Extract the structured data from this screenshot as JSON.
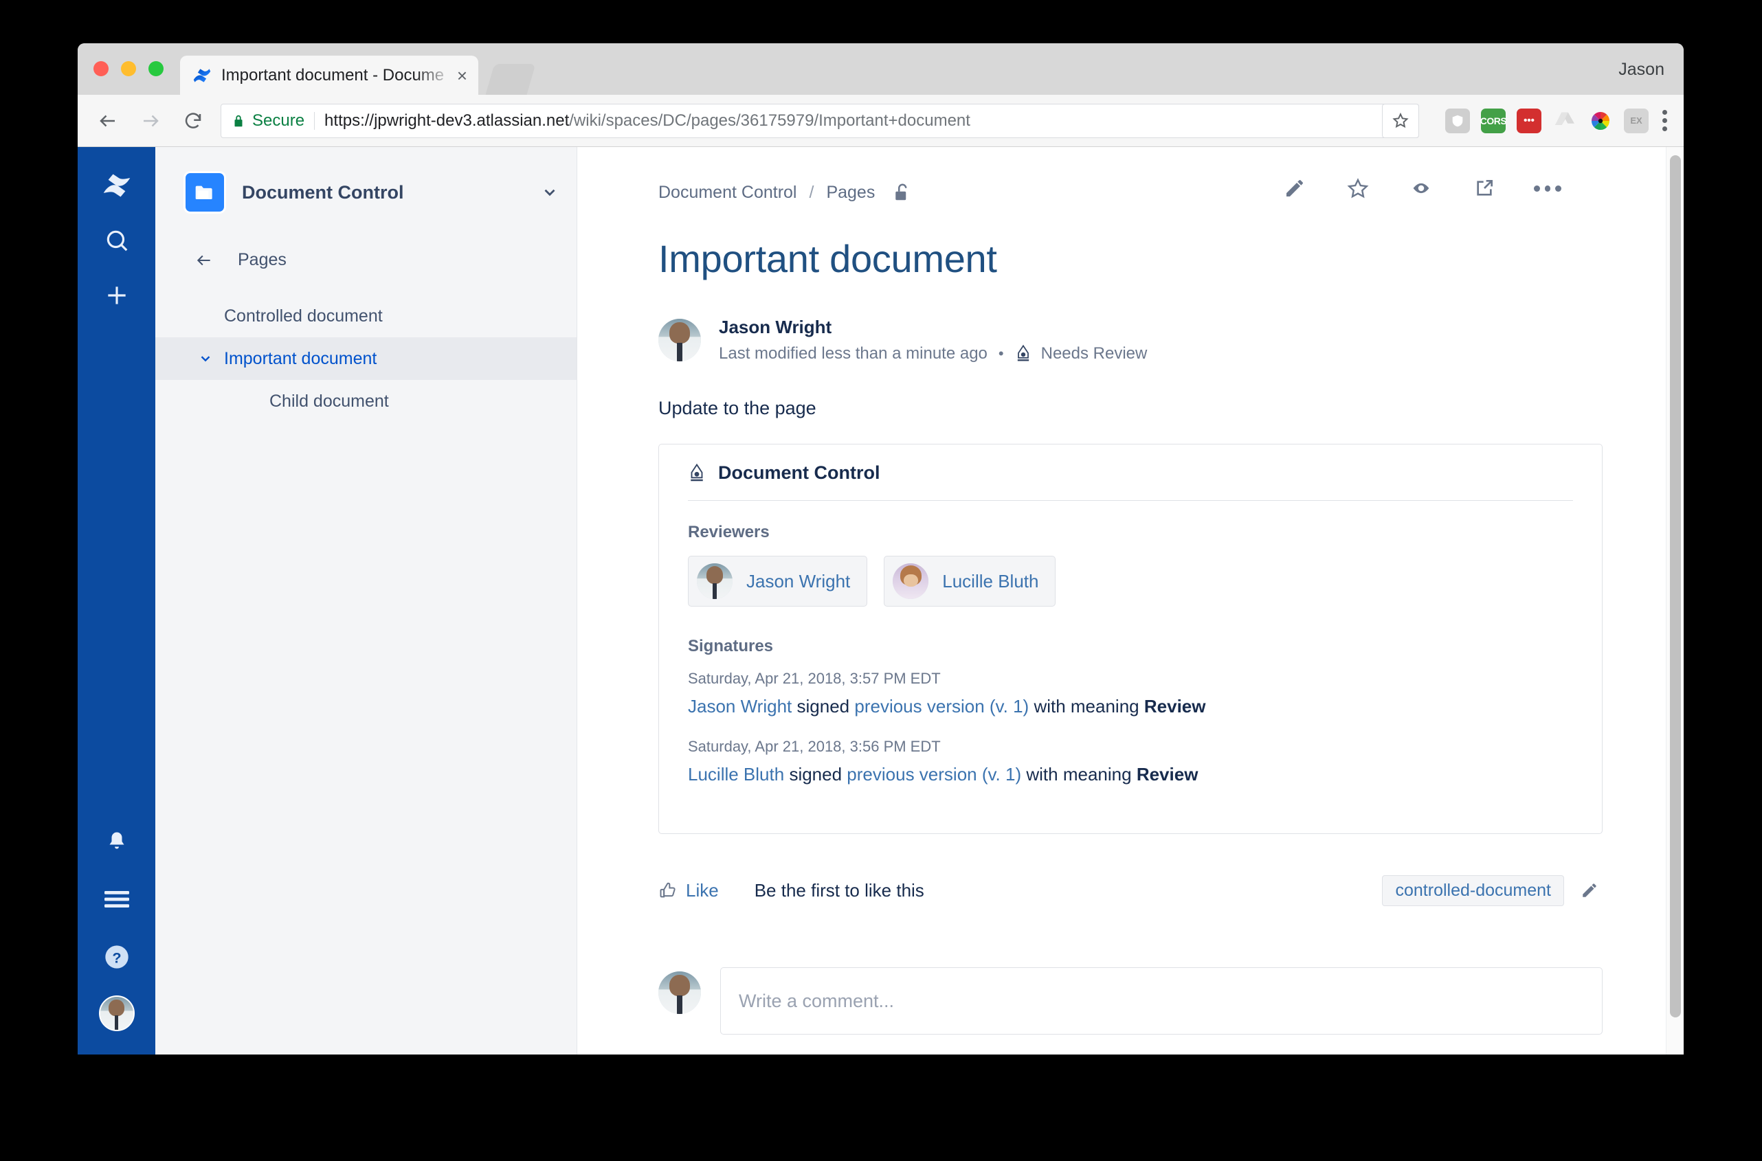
{
  "browser": {
    "profile_name": "Jason",
    "tab": {
      "title": "Important document - Docume",
      "close_label": "×",
      "favicon": "confluence-logo-icon"
    },
    "omnibox": {
      "security_label": "Secure",
      "url_scheme": "https://",
      "url_host": "jpwright-dev3.atlassian.net",
      "url_path": "/wiki/spaces/DC/pages/36175979/Important+document"
    },
    "extensions": [
      {
        "name": "shield-extension-icon",
        "label": ""
      },
      {
        "name": "cors-extension-icon",
        "label": "CORS"
      },
      {
        "name": "lastpass-extension-icon",
        "label": "•••"
      },
      {
        "name": "google-drive-extension-icon",
        "label": ""
      },
      {
        "name": "color-wheel-extension-icon",
        "label": ""
      },
      {
        "name": "ex-upload-extension-icon",
        "label": "EX"
      }
    ]
  },
  "rail": {
    "items": [
      {
        "name": "confluence-logo-icon"
      },
      {
        "name": "search-icon"
      },
      {
        "name": "create-icon"
      }
    ],
    "bottom_items": [
      {
        "name": "notifications-bell-icon"
      },
      {
        "name": "app-switcher-icon"
      },
      {
        "name": "help-icon"
      },
      {
        "name": "user-avatar"
      }
    ]
  },
  "sidebar": {
    "space_name": "Document Control",
    "space_icon": "folder-icon",
    "back_label": "Pages",
    "tree": [
      {
        "label": "Controlled document",
        "selected": false,
        "child": false,
        "expandable": false
      },
      {
        "label": "Important document",
        "selected": true,
        "child": false,
        "expandable": true
      },
      {
        "label": "Child document",
        "selected": false,
        "child": true,
        "expandable": false
      }
    ]
  },
  "page": {
    "breadcrumb": {
      "space": "Document Control",
      "separator": "/",
      "section": "Pages",
      "restriction_icon": "unlocked-padlock-icon"
    },
    "actions": [
      {
        "name": "edit-page-icon"
      },
      {
        "name": "favorite-star-icon"
      },
      {
        "name": "watch-eye-icon"
      },
      {
        "name": "share-icon"
      },
      {
        "name": "more-actions-icon"
      }
    ],
    "title": "Important document",
    "byline": {
      "author": "Jason Wright",
      "modified": "Last modified less than a minute ago",
      "bullet": "•",
      "status_icon": "pen-nib-icon",
      "status": "Needs Review"
    },
    "body_text": "Update to the page",
    "document_control": {
      "panel_icon": "pen-nib-icon",
      "panel_title": "Document Control",
      "reviewers_label": "Reviewers",
      "reviewers": [
        {
          "name": "Jason Wright",
          "avatar": "male-avatar"
        },
        {
          "name": "Lucille Bluth",
          "avatar": "female-avatar"
        }
      ],
      "signatures_label": "Signatures",
      "signatures": [
        {
          "timestamp": "Saturday, Apr 21, 2018, 3:57 PM EDT",
          "signer": "Jason Wright",
          "verb": "signed",
          "version_link": "previous version (v. 1)",
          "with_meaning": "with meaning",
          "meaning": "Review"
        },
        {
          "timestamp": "Saturday, Apr 21, 2018, 3:56 PM EDT",
          "signer": "Lucille Bluth",
          "verb": "signed",
          "version_link": "previous version (v. 1)",
          "with_meaning": "with meaning",
          "meaning": "Review"
        }
      ]
    },
    "footer": {
      "like_icon": "thumbs-up-icon",
      "like_label": "Like",
      "like_note": "Be the first to like this",
      "label_chip": "controlled-document",
      "label_edit_icon": "pencil-icon"
    },
    "comment": {
      "placeholder": "Write a comment...",
      "avatar": "male-avatar"
    }
  },
  "colors": {
    "rail_blue": "#0c4ba0",
    "sidebar_bg": "#f4f5f7",
    "title_blue": "#205081",
    "link_blue": "#3b73af",
    "selected_blue": "#0052cc"
  }
}
